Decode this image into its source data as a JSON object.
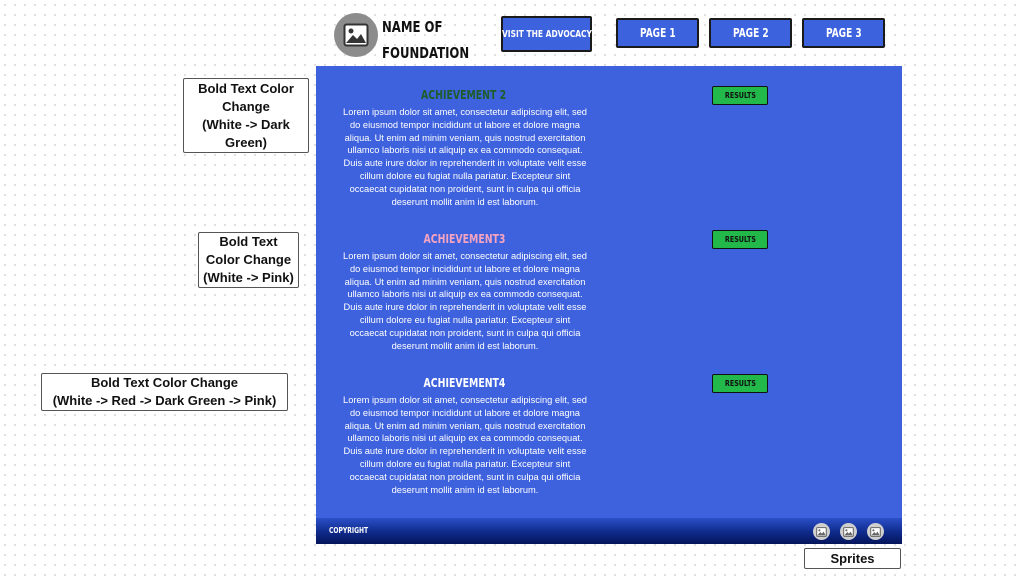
{
  "header": {
    "logo_icon": "image-placeholder-icon",
    "org_name_line1": "NAME OF",
    "org_name_line2": "FOUNDATION",
    "advocacy_button": "VISIT THE ADVOCACY",
    "pages": [
      "PAGE 1",
      "PAGE 2",
      "PAGE 3"
    ]
  },
  "colors": {
    "panel_bg": "#3e62de",
    "button_bg": "#3d62de",
    "results_bg": "#22b84a",
    "achievement2_title": "#1b5e2a",
    "achievement3_title": "#f4a3c0",
    "achievement4_title": "#ffffff"
  },
  "achievements": [
    {
      "title": "ACHIEVEMENT 2",
      "body": "Lorem ipsum dolor sit amet, consectetur adipiscing elit, sed do eiusmod tempor incididunt ut labore et dolore magna aliqua. Ut enim ad minim veniam, quis nostrud exercitation ullamco laboris nisi ut aliquip ex ea commodo consequat. Duis aute irure dolor in reprehenderit in voluptate velit esse cillum dolore eu fugiat nulla pariatur. Excepteur sint occaecat cupidatat non proident, sunt in culpa qui officia deserunt mollit anim id est laborum.",
      "button": "RESULTS"
    },
    {
      "title": "ACHIEVEMENT3",
      "body": "Lorem ipsum dolor sit amet, consectetur adipiscing elit, sed do eiusmod tempor incididunt ut labore et dolore magna aliqua. Ut enim ad minim veniam, quis nostrud exercitation ullamco laboris nisi ut aliquip ex ea commodo consequat. Duis aute irure dolor in reprehenderit in voluptate velit esse cillum dolore eu fugiat nulla pariatur. Excepteur sint occaecat cupidatat non proident, sunt in culpa qui officia deserunt mollit anim id est laborum.",
      "button": "RESULTS"
    },
    {
      "title": "ACHIEVEMENT4",
      "body": "Lorem ipsum dolor sit amet, consectetur adipiscing elit, sed do eiusmod tempor incididunt ut labore et dolore magna aliqua. Ut enim ad minim veniam, quis nostrud exercitation ullamco laboris nisi ut aliquip ex ea commodo consequat. Duis aute irure dolor in reprehenderit in voluptate velit esse cillum dolore eu fugiat nulla pariatur. Excepteur sint occaecat cupidatat non proident, sunt in culpa qui officia deserunt mollit anim id est laborum.",
      "button": "RESULTS"
    }
  ],
  "footer": {
    "copyright": "COPYRIGHT",
    "sprite_icons": [
      "image-placeholder-icon",
      "image-placeholder-icon",
      "image-placeholder-icon"
    ]
  },
  "annotations": {
    "note1": "Bold Text Color\nChange\n(White -> Dark\nGreen)",
    "note2": "Bold Text\nColor Change\n(White -> Pink)",
    "note3": "Bold Text Color Change\n(White -> Red -> Dark Green -> Pink)",
    "note4": "Sprites"
  }
}
